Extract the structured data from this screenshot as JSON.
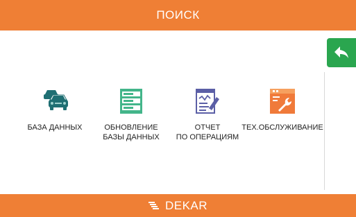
{
  "header": {
    "title": "ПОИСК"
  },
  "footer": {
    "logo_text": "DEKAR"
  },
  "tiles": [
    {
      "label": "БАЗА ДАННЫХ",
      "icon": "cars-database-icon"
    },
    {
      "label_line1": "ОБНОВЛЕНИЕ",
      "label_line2": "БАЗЫ ДАННЫХ",
      "icon": "database-update-icon"
    },
    {
      "label_line1": "ОТЧЕТ",
      "label_line2": "ПО ОПЕРАЦИЯМ",
      "icon": "report-edit-icon"
    },
    {
      "label": "ТЕХ.ОБСЛУЖИВАНИЕ",
      "icon": "maintenance-wrench-icon"
    }
  ],
  "back_button": {
    "icon": "back-arrow-icon"
  },
  "colors": {
    "bar": "#ef7f35",
    "back": "#2aa64f",
    "cars": "#1f6f73",
    "database": "#43b58a",
    "report": "#5b5fa6",
    "maintenance": "#f07a3a"
  }
}
